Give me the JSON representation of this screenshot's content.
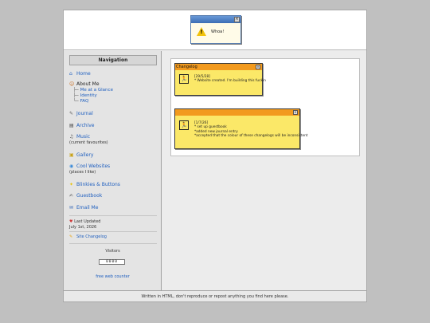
{
  "header": {
    "popup_text": "Whoa!"
  },
  "sidebar": {
    "title": "Navigation",
    "items": [
      {
        "label": "Home",
        "icon": "⌂",
        "icon_name": "home-icon"
      },
      {
        "label": "About Me",
        "icon": "☺",
        "icon_name": "person-icon"
      },
      {
        "label": "Journal",
        "icon": "✎",
        "icon_name": "journal-icon"
      },
      {
        "label": "Archive",
        "icon": "▤",
        "icon_name": "archive-icon"
      },
      {
        "label": "Music",
        "icon": "♫",
        "icon_name": "music-icon"
      },
      {
        "label": "Gallery",
        "icon": "▣",
        "icon_name": "gallery-icon"
      },
      {
        "label": "Cool Websites",
        "icon": "◉",
        "icon_name": "globe-icon"
      },
      {
        "label": "Blinkies & Buttons",
        "icon": "✦",
        "icon_name": "star-icon"
      },
      {
        "label": "Guestbook",
        "icon": "✍",
        "icon_name": "guestbook-icon"
      },
      {
        "label": "Email Me",
        "icon": "✉",
        "icon_name": "email-icon"
      }
    ],
    "about_sub": [
      "Me at a Glance",
      "Identity",
      "FAQ"
    ],
    "music_note": "(current favourites)",
    "websites_note": "(places I like)",
    "last_updated_label": "Last Updated",
    "last_updated_date": "July 1st, 2026",
    "site_changelog": "Site Changelog",
    "visitors_label": "Visitors",
    "counter_value": "0000",
    "counter_link": "free web counter"
  },
  "changelog": {
    "title": "Changelog",
    "entry1": {
      "date": "[29/5/28]",
      "lines": [
        "* Website created. I'm building this fuckin"
      ]
    },
    "entry2": {
      "date": "[1/7/26]",
      "lines": [
        "* set up guestbook",
        "*added new journal entry",
        "*accepted that the colour of these changelogs will be inconsistent"
      ]
    }
  },
  "footer": {
    "text": "Written in HTML, don't reproduce or repost anything you find here please."
  },
  "colors": {
    "changelog_bar": "#f29a1e",
    "changelog_body": "#fbe868",
    "link": "#1f5fbf"
  }
}
